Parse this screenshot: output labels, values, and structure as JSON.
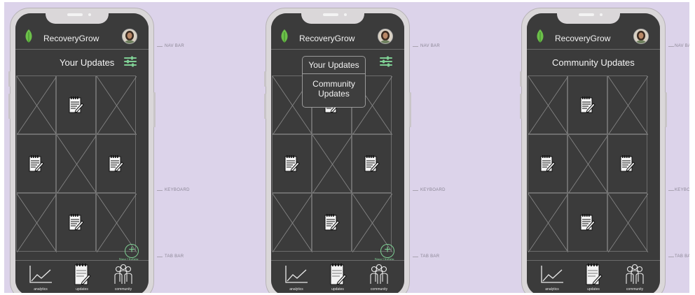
{
  "app": {
    "name": "RecoveryGrow"
  },
  "annotations": {
    "nav_bar": "NAV BAR",
    "keyboard": "KEYBOARD",
    "tab_bar": "TAB BAR"
  },
  "screens": [
    {
      "title": "Your Updates",
      "show_filter": true,
      "show_fab": true,
      "dropdown": null
    },
    {
      "title": "Your Updates",
      "show_filter": true,
      "show_fab": true,
      "dropdown": {
        "item1": "Your Updates",
        "item2_line1": "Community",
        "item2_line2": "Updates"
      }
    },
    {
      "title": "Community Updates",
      "show_filter": false,
      "show_fab": false,
      "dropdown": null
    }
  ],
  "fab": {
    "symbol": "+",
    "label": "New Update"
  },
  "tabs": [
    {
      "label": "analytics",
      "icon": "line-chart-icon"
    },
    {
      "label": "updates",
      "icon": "notepad-icon"
    },
    {
      "label": "community",
      "icon": "people-icon"
    }
  ],
  "grid_pattern": [
    "placeholder",
    "note",
    "placeholder",
    "note",
    "placeholder",
    "note",
    "placeholder",
    "note",
    "placeholder"
  ],
  "colors": {
    "background": "#dcd3ea",
    "screen": "#3b3b3b",
    "accent": "#7fcf94"
  }
}
